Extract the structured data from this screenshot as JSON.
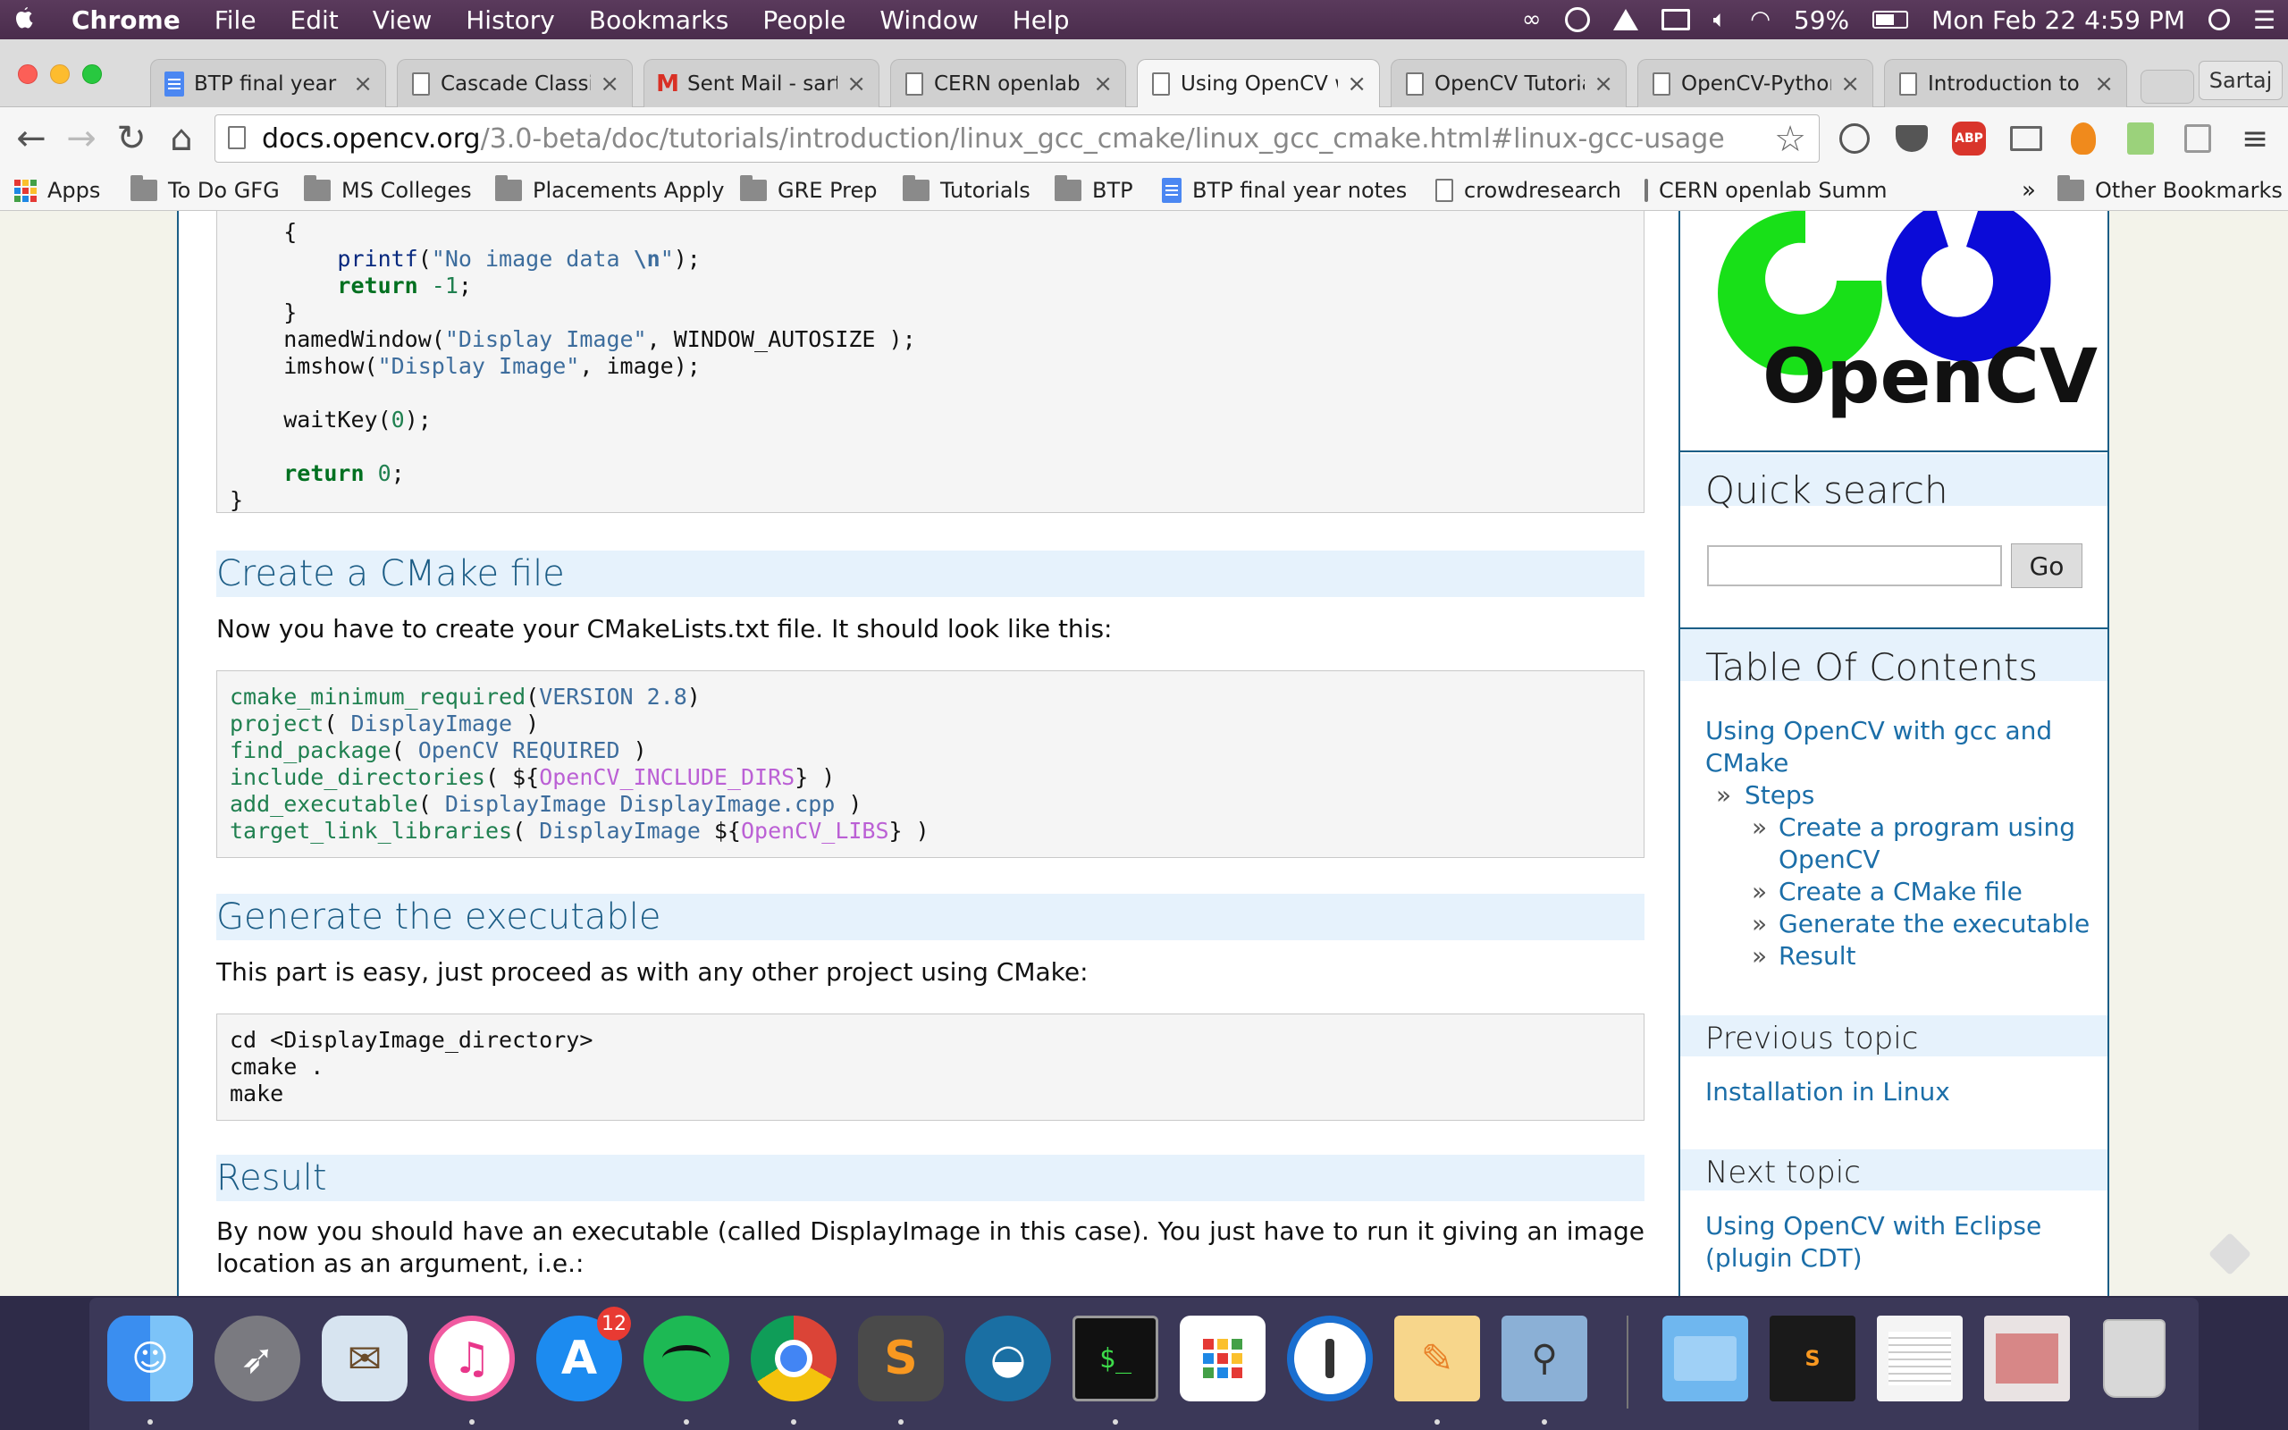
{
  "menubar": {
    "app": "Chrome",
    "items": [
      "File",
      "Edit",
      "View",
      "History",
      "Bookmarks",
      "People",
      "Window",
      "Help"
    ],
    "battery": "59%",
    "clock": "Mon Feb 22  4:59 PM"
  },
  "tabs": [
    {
      "title": "BTP final year n"
    },
    {
      "title": "Cascade Classifi"
    },
    {
      "title": "Sent Mail - sarta"
    },
    {
      "title": "CERN openlab S"
    },
    {
      "title": "Using OpenCV w"
    },
    {
      "title": "OpenCV Tutorial"
    },
    {
      "title": "OpenCV-Python"
    },
    {
      "title": "Introduction to C"
    }
  ],
  "profile_name": "Sartaj",
  "address": {
    "domain": "docs.opencv.org",
    "path": "/3.0-beta/doc/tutorials/introduction/linux_gcc_cmake/linux_gcc_cmake.html#linux-gcc-usage"
  },
  "bookmarks": [
    {
      "label": "Apps"
    },
    {
      "label": "To Do GFG"
    },
    {
      "label": "MS Colleges"
    },
    {
      "label": "Placements Apply"
    },
    {
      "label": "GRE Prep"
    },
    {
      "label": "Tutorials"
    },
    {
      "label": "BTP"
    },
    {
      "label": "BTP final year notes"
    },
    {
      "label": "crowdresearch"
    },
    {
      "label": "CERN openlab Summ"
    }
  ],
  "other_bookmarks": "Other Bookmarks",
  "page": {
    "code_top_lines": [
      "    {",
      "        printf(\"No image data \\n\");",
      "        return -1;",
      "    }",
      "    namedWindow(\"Display Image\", WINDOW_AUTOSIZE );",
      "    imshow(\"Display Image\", image);",
      "",
      "    waitKey(0);",
      "",
      "    return 0;",
      "}"
    ],
    "section_cmake": "Create a CMake file",
    "para_cmake": "Now you have to create your CMakeLists.txt file. It should look like this:",
    "cmake_lines": [
      "cmake_minimum_required(VERSION 2.8)",
      "project( DisplayImage )",
      "find_package( OpenCV REQUIRED )",
      "include_directories( ${OpenCV_INCLUDE_DIRS} )",
      "add_executable( DisplayImage DisplayImage.cpp )",
      "target_link_libraries( DisplayImage ${OpenCV_LIBS} )"
    ],
    "section_generate": "Generate the executable",
    "para_generate": "This part is easy, just proceed as with any other project using CMake:",
    "shell_lines": [
      "cd <DisplayImage_directory>",
      "cmake .",
      "make"
    ],
    "section_result": "Result",
    "para_result": "By now you should have an executable (called DisplayImage in this case). You just have to run it giving an image location as an argument, i.e.:"
  },
  "sidebar": {
    "logo_text": "OpenCV",
    "quick_search": "Quick search",
    "go_label": "Go",
    "toc_title": "Table Of Contents",
    "toc_main": "Using OpenCV with gcc and CMake",
    "toc_steps": "Steps",
    "toc_items": [
      "Create a program using OpenCV",
      "Create a CMake file",
      "Generate the executable",
      "Result"
    ],
    "prev_title": "Previous topic",
    "prev_link": "Installation in Linux",
    "next_title": "Next topic",
    "next_link": "Using OpenCV with Eclipse (plugin CDT)"
  },
  "dock": {
    "appstore_badge": "12"
  }
}
